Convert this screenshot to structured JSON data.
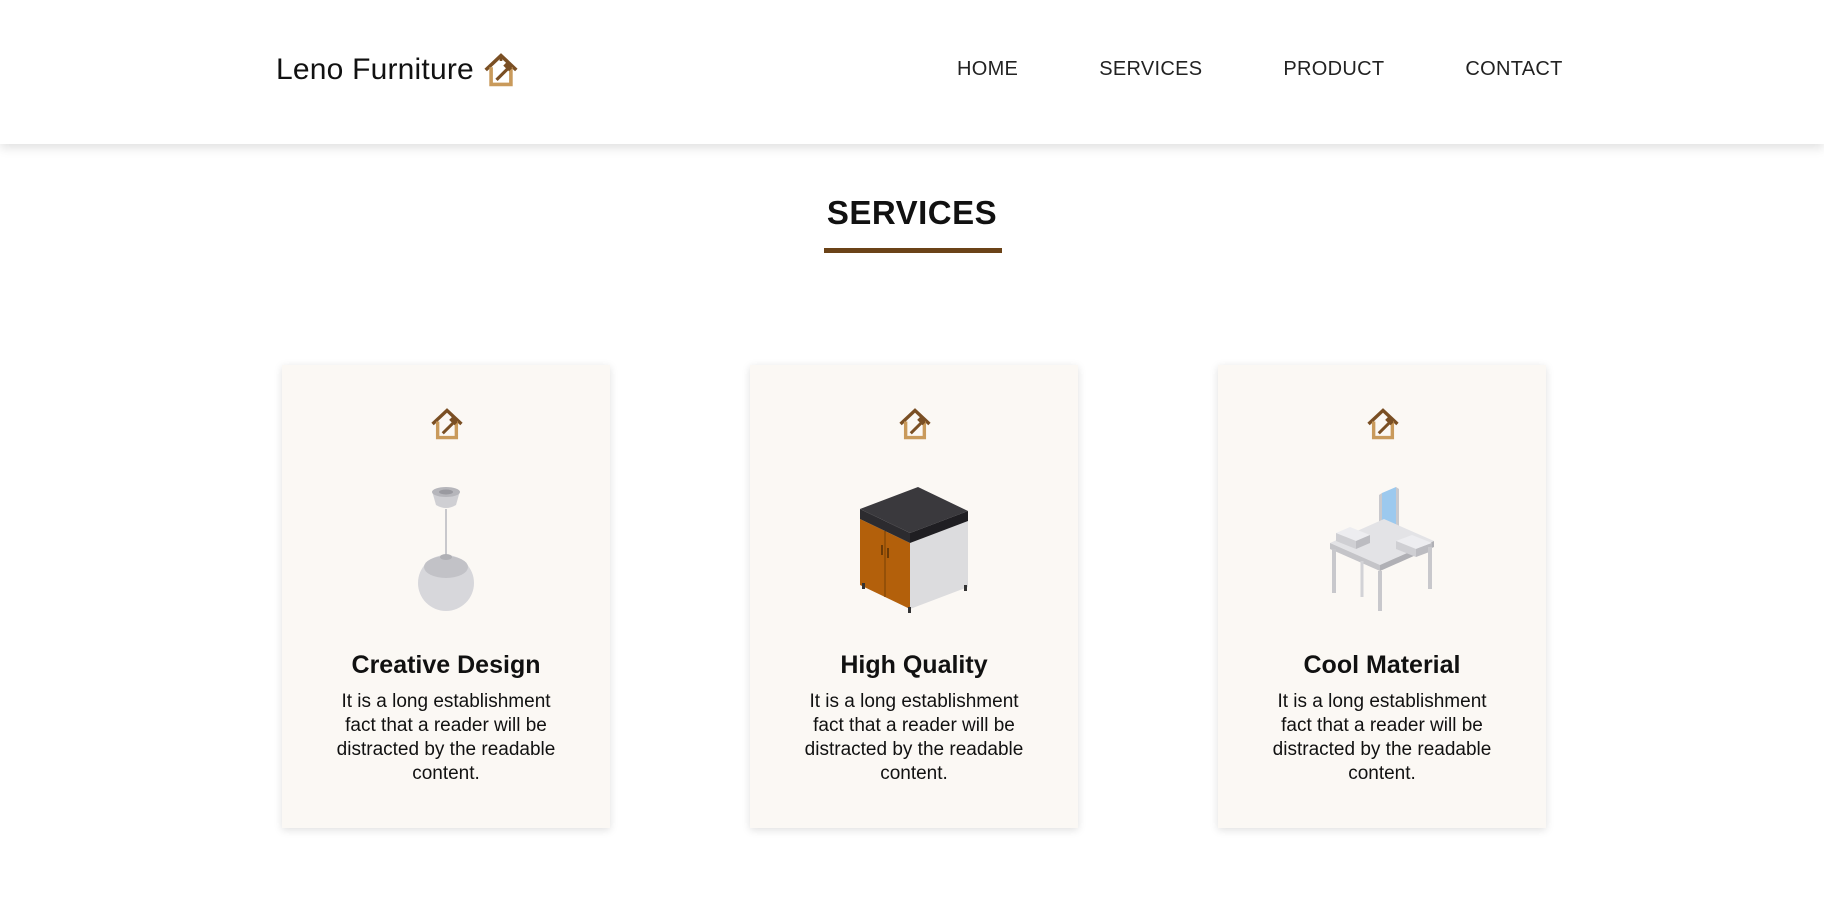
{
  "nav": {
    "brand": "Leno Furniture",
    "brand_icon": "house-hammer-logo-icon",
    "links": [
      "HOME",
      "SERVICES",
      "PRODUCT",
      "CONTACT"
    ]
  },
  "section": {
    "title": "SERVICES"
  },
  "cards": [
    {
      "title": "Creative Design",
      "text": "It is a long establishment fact that a reader will be distracted by the readable content.",
      "icon": "house-hammer-logo-icon",
      "illustration": "pendant-lamp-icon"
    },
    {
      "title": "High Quality",
      "text": "It is a long establishment fact that a reader will be distracted by the readable content.",
      "icon": "house-hammer-logo-icon",
      "illustration": "kitchen-cabinet-icon"
    },
    {
      "title": "Cool Material",
      "text": "It is a long establishment fact that a reader will be distracted by the readable content.",
      "icon": "house-hammer-logo-icon",
      "illustration": "vanity-desk-icon"
    }
  ],
  "colors": {
    "accent": "#6b4318",
    "logo_dark": "#7a4f24",
    "logo_light": "#c99a5b",
    "card_bg": "#fbf8f4"
  }
}
